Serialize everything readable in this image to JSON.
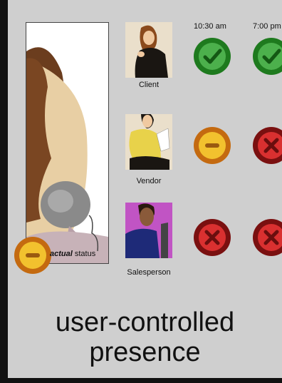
{
  "times": {
    "col1": "10:30 am",
    "col2": "7:00 pm"
  },
  "rows": [
    {
      "name": "Client",
      "status": [
        "available",
        "available"
      ]
    },
    {
      "name": "Vendor",
      "status": [
        "away",
        "busy"
      ]
    },
    {
      "name": "Salesperson",
      "status": [
        "busy",
        "busy"
      ]
    }
  ],
  "actual_status": {
    "emphasis": "actual",
    "rest": " status",
    "icon": "away"
  },
  "caption": {
    "line1": "user-controlled",
    "line2": "presence"
  },
  "colors": {
    "available_ring": "#1e7a1e",
    "available_fill": "#4cb04c",
    "away_ring": "#c46a10",
    "away_fill": "#f2c12e",
    "busy_ring": "#7a1010",
    "busy_fill": "#d93030"
  }
}
